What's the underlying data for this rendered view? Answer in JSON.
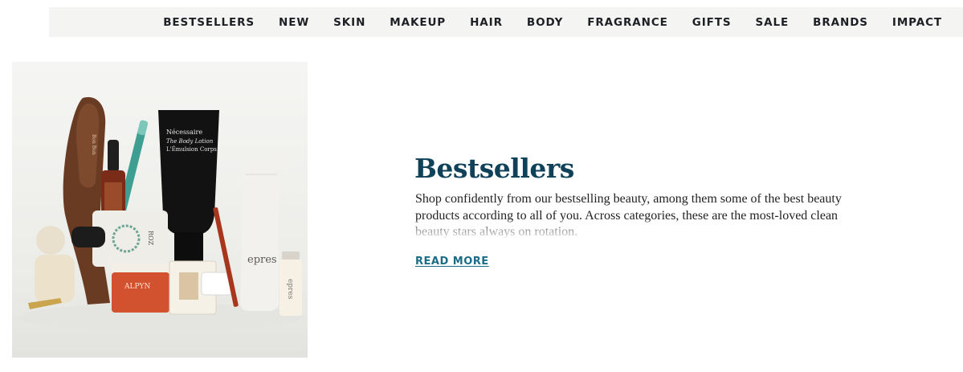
{
  "nav": {
    "items": [
      "BESTSELLERS",
      "NEW",
      "SKIN",
      "MAKEUP",
      "HAIR",
      "BODY",
      "FRAGRANCE",
      "GIFTS",
      "SALE",
      "BRANDS",
      "IMPACT"
    ]
  },
  "hero": {
    "title": "Bestsellers",
    "description": "Shop confidently from our bestselling beauty, among them some of the best beauty products according to all of you. Across categories, these are the most-loved clean beauty stars always on rotation.",
    "read_more_label": "READ MORE",
    "image_labels": {
      "tube_brand": "Nécessaire",
      "tube_line1": "The Body Lotion",
      "tube_line2": "L'Émulsion Corps",
      "jar_brand": "ALPYN",
      "jar2_brand": "ROZ",
      "bottle_brand": "epres",
      "vial_brand": "epres",
      "brush_brand": "Bon Bon"
    }
  },
  "colors": {
    "title": "#0f4159",
    "link": "#1b6c86",
    "nav_bg": "#f4f4f2"
  }
}
